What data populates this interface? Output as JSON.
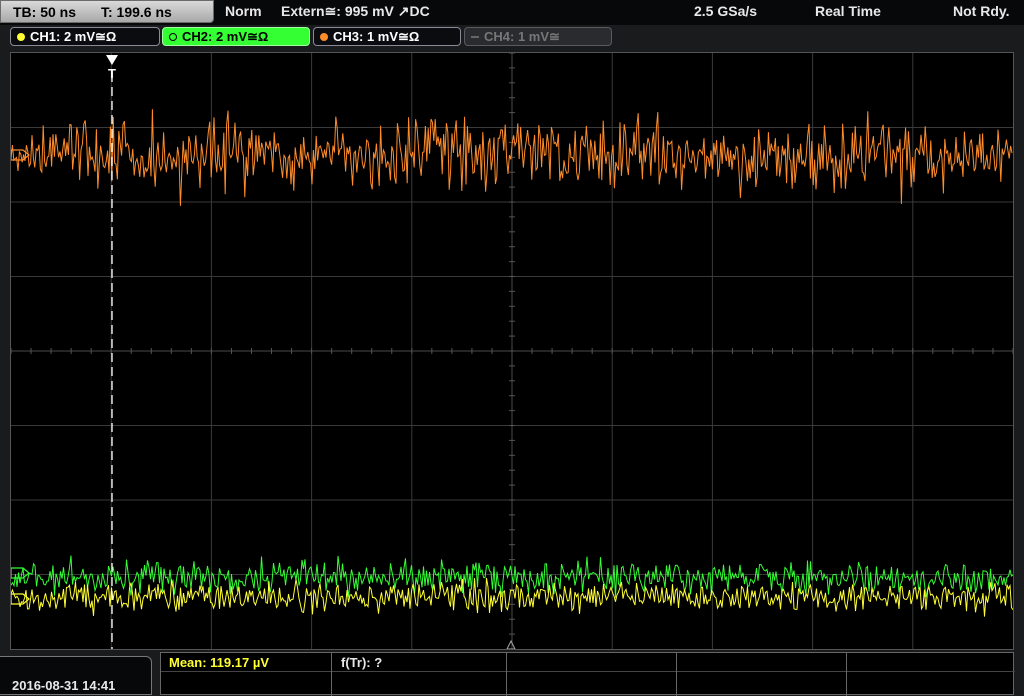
{
  "topbar": {
    "timebase": "TB: 50 ns",
    "trigger_time": "T: 199.6 ns",
    "trigger_mode": "Norm",
    "trigger_source": "Extern≅: 995 mV ↗DC",
    "sample_rate": "2.5 GSa/s",
    "acq_mode": "Real Time",
    "status": "Not Rdy."
  },
  "channels": [
    {
      "label": "CH1: 2 mV≅Ω",
      "color": "#ffff33"
    },
    {
      "label": "CH2: 2 mV≅Ω",
      "color": "#33ff33"
    },
    {
      "label": "CH3: 1 mV≅Ω",
      "color": "#ff8c2a"
    },
    {
      "label": "CH4: 1 mV≅",
      "color": "#666666"
    }
  ],
  "trigger_marker": "T",
  "bottom": {
    "datetime": "2016-08-31 14:41",
    "mean": "Mean: 119.17 µV",
    "ftr": "f(Tr): ?"
  }
}
